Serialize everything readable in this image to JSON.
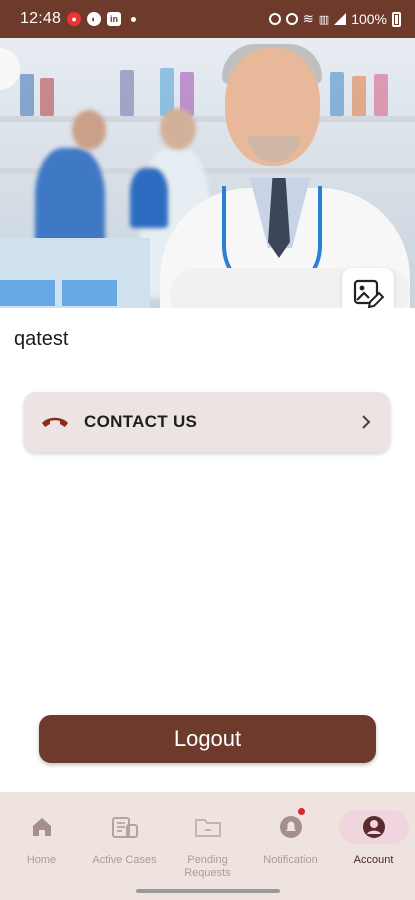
{
  "status_bar": {
    "time": "12:48",
    "battery": "100%",
    "background": "#6e3a2b"
  },
  "profile": {
    "username": "qatest",
    "edit_photo_icon": "edit-image-icon"
  },
  "contact": {
    "label": "CONTACT US",
    "icon": "phone-hangup-icon",
    "icon_color": "#8e2a1c"
  },
  "logout": {
    "label": "Logout",
    "color": "#6e3a2b"
  },
  "bottom_nav": {
    "items": [
      {
        "label": "Home",
        "icon": "home-icon"
      },
      {
        "label": "Active Cases",
        "icon": "cases-icon"
      },
      {
        "label": "Pending Requests",
        "icon": "folder-icon"
      },
      {
        "label": "Notification",
        "icon": "bell-icon"
      },
      {
        "label": "Account",
        "icon": "account-icon"
      }
    ],
    "active": "Account"
  }
}
